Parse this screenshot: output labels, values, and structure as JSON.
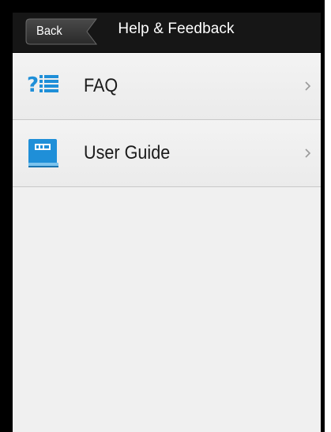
{
  "header": {
    "back_label": "Back",
    "title": "Help & Feedback"
  },
  "list": {
    "items": [
      {
        "label": "FAQ",
        "icon": "faq-icon"
      },
      {
        "label": "User Guide",
        "icon": "user-guide-book-icon"
      }
    ]
  },
  "colors": {
    "titlebar": "#161616",
    "list_background": "#f0f0f0",
    "icon_blue": "#1f8fd8",
    "text": "#1b1b1b"
  }
}
